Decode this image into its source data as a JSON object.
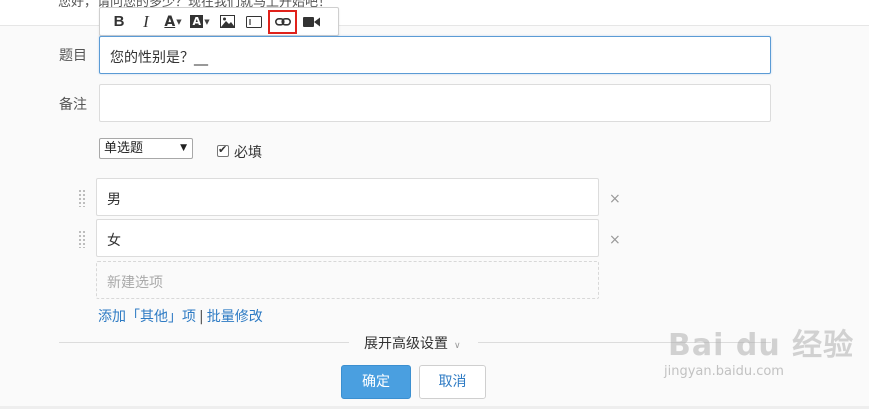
{
  "header": {
    "partial_text": "您好，请问您的多少？现在我们就马上开始吧！"
  },
  "toolbar": {
    "items": [
      {
        "label": "B",
        "icon": "bold-icon"
      },
      {
        "label": "I",
        "icon": "italic-icon"
      },
      {
        "label": "A",
        "icon": "font-color-icon"
      },
      {
        "label": "A",
        "icon": "background-color-icon"
      },
      {
        "icon": "image-icon"
      },
      {
        "icon": "text-box-icon"
      },
      {
        "icon": "link-icon",
        "highlighted": true
      },
      {
        "icon": "video-icon"
      }
    ],
    "highlight_color": "#e0221b"
  },
  "form": {
    "title_label": "题目",
    "title_value": "您的性别是？__",
    "note_label": "备注",
    "note_value": "",
    "type_select": "单选题",
    "required_label": "必填",
    "required_checked": true
  },
  "options": [
    {
      "label": "男"
    },
    {
      "label": "女"
    }
  ],
  "new_option_placeholder": "新建选项",
  "links": {
    "add_other": "添加「其他」项",
    "separator": "|",
    "batch_edit": "批量修改"
  },
  "advanced_settings": "展开高级设置",
  "buttons": {
    "confirm": "确定",
    "cancel": "取消"
  },
  "colors": {
    "primary": "#4a9fe0",
    "link": "#2e7bc4",
    "focus_border": "#5b9bd5"
  },
  "watermark": {
    "brand": "Bai du 经验",
    "url": "jingyan.baidu.com"
  }
}
